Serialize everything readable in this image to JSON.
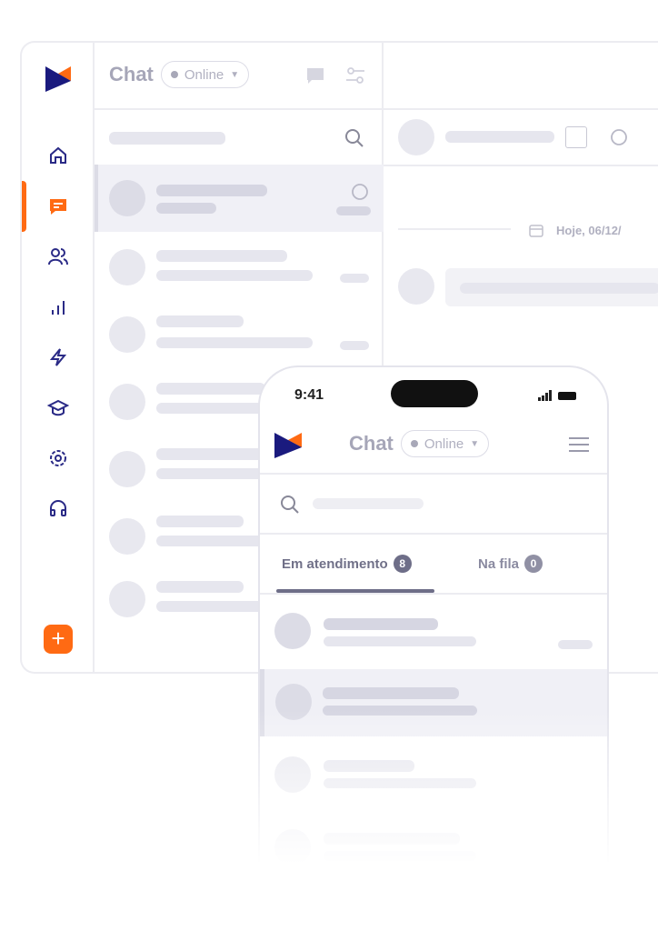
{
  "desktop": {
    "title": "Chat",
    "status": "Online",
    "date_label": "Hoje, 06/12/",
    "sidebar": [
      "home-icon",
      "chat-icon",
      "users-icon",
      "reports-icon",
      "automation-icon",
      "academy-icon",
      "settings-icon",
      "support-icon"
    ],
    "accent": "#ff6a13",
    "brand": "#1a1a7e"
  },
  "phone": {
    "time": "9:41",
    "title": "Chat",
    "status": "Online",
    "tabs": [
      {
        "label": "Em atendimento",
        "count": "8"
      },
      {
        "label": "Na fila",
        "count": "0"
      }
    ]
  }
}
